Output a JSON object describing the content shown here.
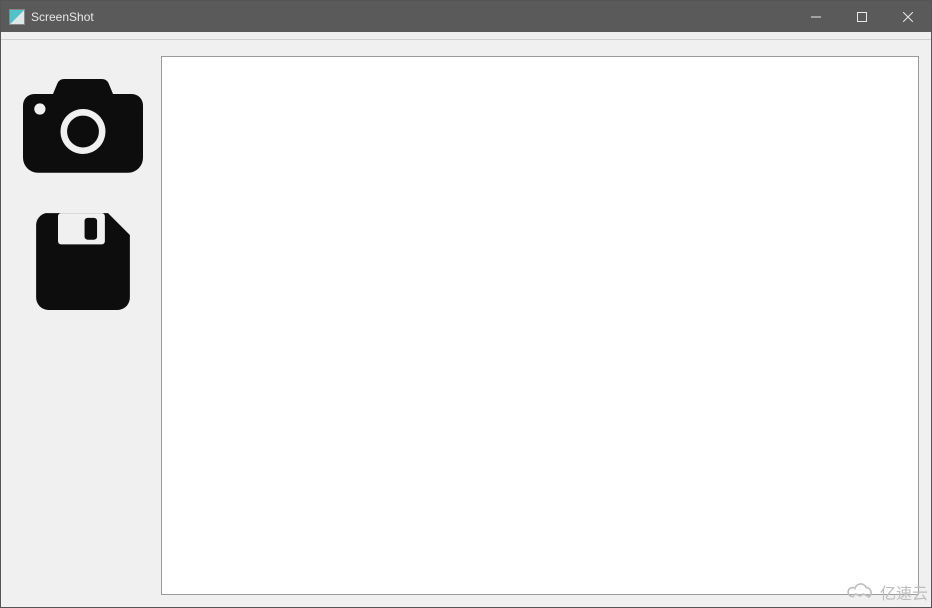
{
  "window": {
    "title": "ScreenShot"
  },
  "sidebar": {
    "capture_label": "Capture",
    "save_label": "Save"
  },
  "watermark": {
    "text": "亿速云"
  }
}
